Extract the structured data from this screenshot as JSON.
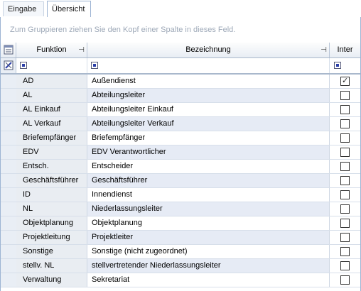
{
  "tabs": [
    {
      "label": "Eingabe",
      "active": false
    },
    {
      "label": "Übersicht",
      "active": true
    }
  ],
  "group_hint": "Zum Gruppieren ziehen Sie den Kopf einer Spalte in dieses Feld.",
  "columns": {
    "funktion": "Funktion",
    "bezeichnung": "Bezeichnung",
    "inter": "Inter"
  },
  "icons": {
    "pin": "pin-icon",
    "column_chooser": "column-chooser-icon",
    "filter_edit": "filter-edit-icon"
  },
  "rows": [
    {
      "funktion": "AD",
      "bezeichnung": "Außendienst",
      "inter": true
    },
    {
      "funktion": "AL",
      "bezeichnung": "Abteilungsleiter",
      "inter": false
    },
    {
      "funktion": "AL Einkauf",
      "bezeichnung": "Abteilungsleiter Einkauf",
      "inter": false
    },
    {
      "funktion": "AL Verkauf",
      "bezeichnung": "Abteilungsleiter Verkauf",
      "inter": false
    },
    {
      "funktion": "Briefempfänger",
      "bezeichnung": "Briefempfänger",
      "inter": false
    },
    {
      "funktion": "EDV",
      "bezeichnung": "EDV Verantwortlicher",
      "inter": false
    },
    {
      "funktion": "Entsch.",
      "bezeichnung": "Entscheider",
      "inter": false
    },
    {
      "funktion": "Geschäftsführer",
      "bezeichnung": "Geschäftsführer",
      "inter": false
    },
    {
      "funktion": "ID",
      "bezeichnung": "Innendienst",
      "inter": false
    },
    {
      "funktion": "NL",
      "bezeichnung": "Niederlassungsleiter",
      "inter": false
    },
    {
      "funktion": "Objektplanung",
      "bezeichnung": "Objektplanung",
      "inter": false
    },
    {
      "funktion": "Projektleitung",
      "bezeichnung": "Projektleiter",
      "inter": false
    },
    {
      "funktion": "Sonstige",
      "bezeichnung": "Sonstige (nicht zugeordnet)",
      "inter": false
    },
    {
      "funktion": "stellv. NL",
      "bezeichnung": "stellvertretender Niederlassungsleiter",
      "inter": false
    },
    {
      "funktion": "Verwaltung",
      "bezeichnung": "Sekretariat",
      "inter": false
    }
  ]
}
